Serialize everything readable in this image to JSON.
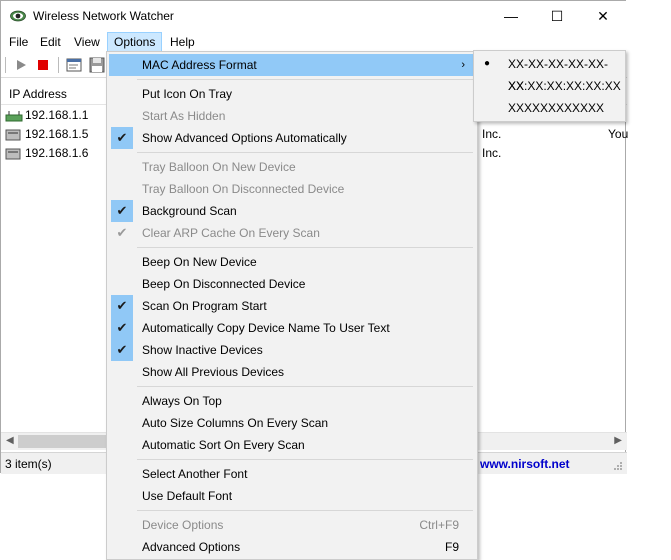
{
  "window": {
    "title": "Wireless Network Watcher",
    "controls": {
      "minimize": "—",
      "maximize": "☐",
      "close": "✕"
    }
  },
  "menubar": {
    "items": [
      {
        "label": "File"
      },
      {
        "label": "Edit"
      },
      {
        "label": "View"
      },
      {
        "label": "Options"
      },
      {
        "label": "Help"
      }
    ]
  },
  "list": {
    "column_header": "IP Address",
    "rows": [
      {
        "ip": "192.168.1.1"
      },
      {
        "ip": "192.168.1.5",
        "extra1": "Inc.",
        "extra2": "You"
      },
      {
        "ip": "192.168.1.6",
        "extra1": "Inc."
      }
    ]
  },
  "status": {
    "count": "3 item(s)",
    "link": "www.nirsoft.net"
  },
  "options_menu": {
    "mac_format": "MAC Address Format",
    "put_icon_on_tray": "Put Icon On Tray",
    "start_as_hidden": "Start As Hidden",
    "show_advanced_options": "Show Advanced Options Automatically",
    "tray_balloon_new": "Tray Balloon On New Device",
    "tray_balloon_disconnected": "Tray Balloon On Disconnected Device",
    "background_scan": "Background Scan",
    "clear_arp_cache": "Clear ARP Cache On Every Scan",
    "beep_new": "Beep On New Device",
    "beep_disconnected": "Beep On Disconnected Device",
    "scan_on_start": "Scan On Program Start",
    "copy_device_name": "Automatically Copy Device Name To User Text",
    "show_inactive": "Show Inactive Devices",
    "show_all_previous": "Show All Previous Devices",
    "always_on_top": "Always On Top",
    "auto_size_columns": "Auto Size Columns On Every Scan",
    "auto_sort": "Automatic Sort On Every Scan",
    "select_font": "Select Another Font",
    "default_font": "Use Default Font",
    "device_options": "Device Options",
    "device_options_shortcut": "Ctrl+F9",
    "advanced_options": "Advanced Options",
    "advanced_options_shortcut": "F9",
    "check_glyph": "✔",
    "submenu_arrow": "›"
  },
  "mac_submenu": {
    "options": [
      {
        "label": "XX-XX-XX-XX-XX-XX",
        "selected": true
      },
      {
        "label": "XX:XX:XX:XX:XX:XX",
        "selected": false
      },
      {
        "label": "XXXXXXXXXXXX",
        "selected": false
      }
    ],
    "radio_glyph": "●"
  },
  "colors": {
    "highlight": "#91c9f7",
    "check_background": "#90c8f6",
    "menu_background": "#f2f2f2",
    "link": "#0000cc",
    "stop_button": "#e00000"
  }
}
